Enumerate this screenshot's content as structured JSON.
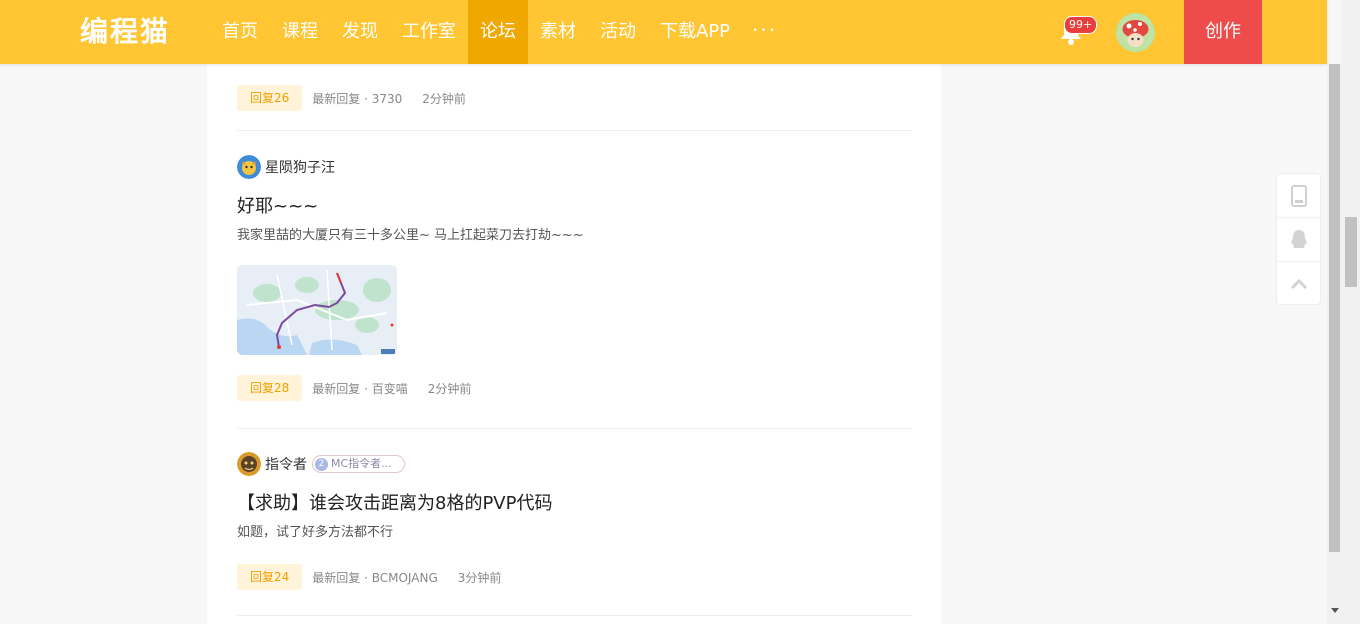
{
  "header": {
    "logo": "编程猫",
    "nav": [
      "首页",
      "课程",
      "发现",
      "工作室",
      "论坛",
      "素材",
      "活动",
      "下载APP"
    ],
    "active_nav": "论坛",
    "more": "···",
    "notification_badge": "99+",
    "create_label": "创作"
  },
  "colors": {
    "header_bg": "#ffc532",
    "active_nav_bg": "#f0a800",
    "create_bg": "#ef4b4b",
    "reply_badge_bg": "#fff3da",
    "reply_badge_text": "#f0a000"
  },
  "posts": [
    {
      "reply": "回复26",
      "latest": "最新回复 · 3730",
      "time": "2分钟前"
    },
    {
      "author": "星陨狗子汪",
      "title": "好耶~~~",
      "summary": "我家里喆的大厦只有三十多公里~ 马上扛起菜刀去打劫~~~",
      "has_image": true,
      "reply": "回复28",
      "latest": "最新回复 · 百变喵",
      "time": "2分钟前"
    },
    {
      "author": "指令者",
      "tag_level": "2",
      "tag": "MC指令者...",
      "title": "【求助】谁会攻击距离为8格的PVP代码",
      "summary": "如题，试了好多方法都不行",
      "reply": "回复24",
      "latest": "最新回复 · BCMOJANG",
      "time": "3分钟前"
    }
  ],
  "side_tools": [
    "phone-icon",
    "qq-icon",
    "back-to-top-icon"
  ]
}
